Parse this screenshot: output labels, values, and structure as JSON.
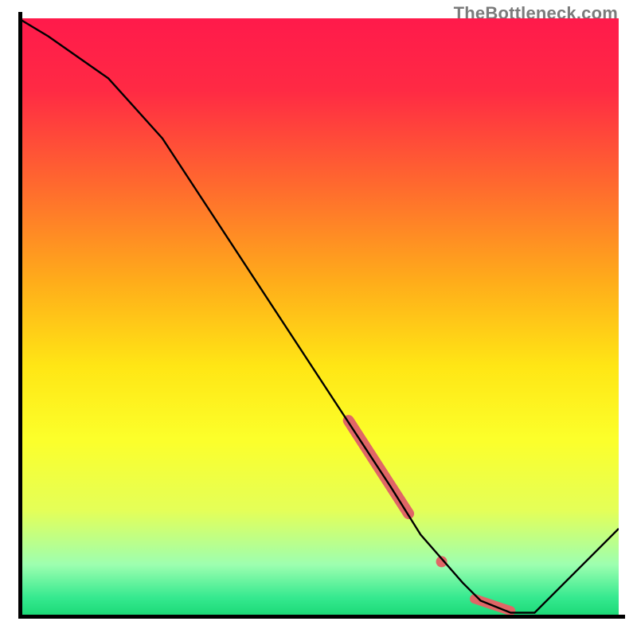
{
  "watermark": "TheBottleneck.com",
  "colors": {
    "line": "#000000",
    "highlight": "#e06666",
    "gradient_stops": [
      {
        "offset": 0.0,
        "color": "#ff1a4b"
      },
      {
        "offset": 0.12,
        "color": "#ff2a44"
      },
      {
        "offset": 0.28,
        "color": "#ff6a2e"
      },
      {
        "offset": 0.44,
        "color": "#ffad1a"
      },
      {
        "offset": 0.58,
        "color": "#ffe615"
      },
      {
        "offset": 0.7,
        "color": "#fcff2a"
      },
      {
        "offset": 0.82,
        "color": "#e4ff58"
      },
      {
        "offset": 0.91,
        "color": "#9dffb0"
      },
      {
        "offset": 0.965,
        "color": "#35e98f"
      },
      {
        "offset": 1.0,
        "color": "#17d672"
      }
    ]
  },
  "chart_data": {
    "type": "line",
    "title": "",
    "xlabel": "",
    "ylabel": "",
    "xlim": [
      0,
      100
    ],
    "ylim": [
      0,
      100
    ],
    "series": [
      {
        "name": "curve",
        "x": [
          0,
          5,
          15,
          24,
          62,
          67,
          74,
          77,
          82,
          86,
          100
        ],
        "y": [
          100,
          97,
          90,
          80,
          22,
          14,
          6,
          3,
          1,
          1,
          15
        ]
      }
    ],
    "highlights": [
      {
        "name": "thick-segment",
        "shape": "segment",
        "x1": 55,
        "y1": 33,
        "x2": 65,
        "y2": 17.5,
        "width": 14
      },
      {
        "name": "dot",
        "shape": "dot",
        "x": 70.5,
        "y": 9.5,
        "r": 7
      },
      {
        "name": "flat-pill",
        "shape": "pill",
        "x1": 76,
        "y1": 3.3,
        "x2": 82,
        "y2": 1.3,
        "width": 12
      }
    ]
  }
}
